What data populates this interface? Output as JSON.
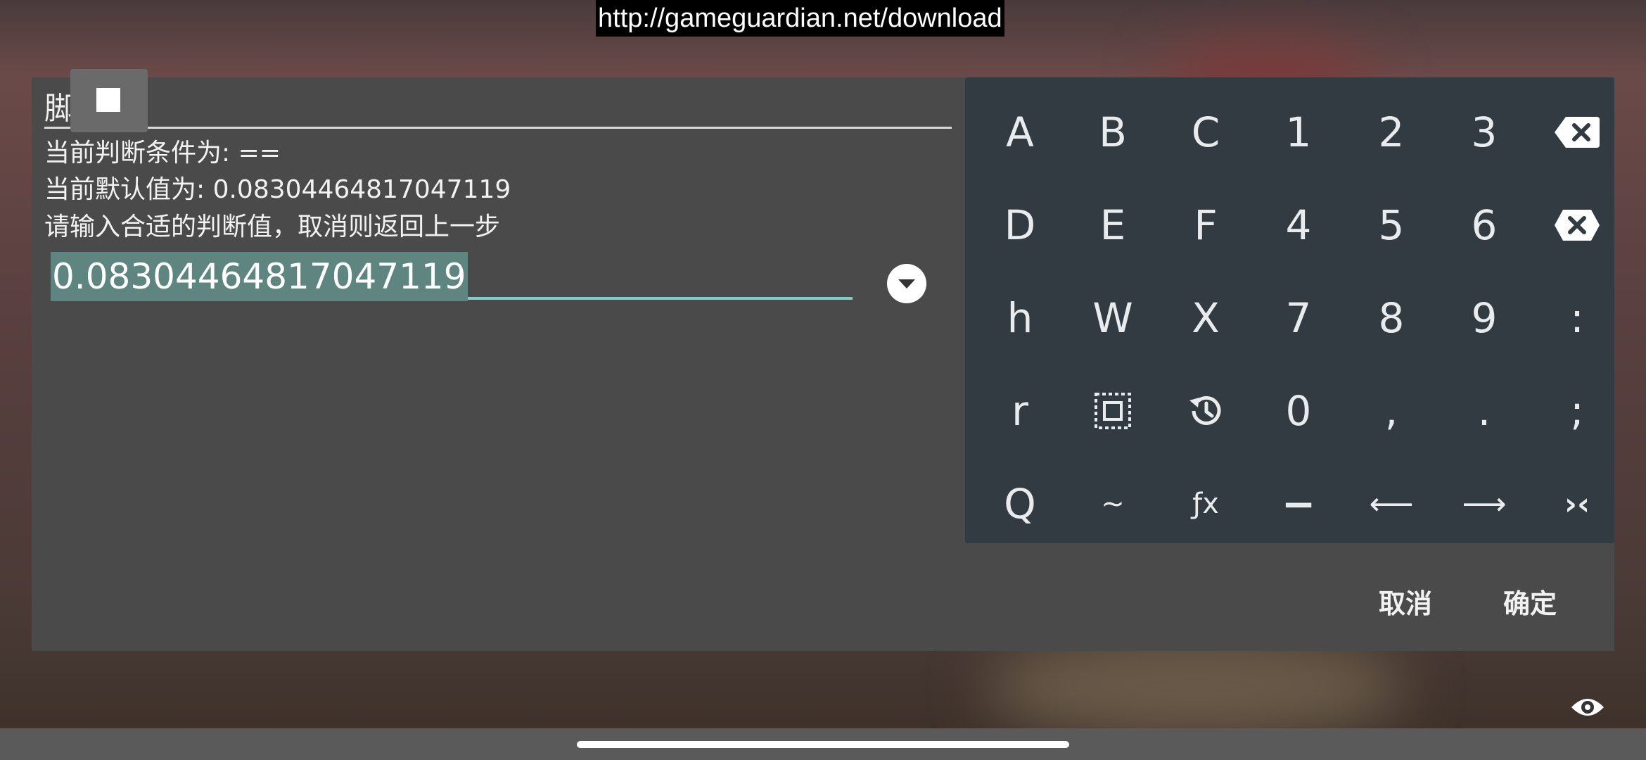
{
  "banner": {
    "url": "http://gameguardian.net/download"
  },
  "dialog": {
    "title": "脚",
    "condition_line": "当前判断条件为: ==",
    "default_line": "当前默认值为: 0.08304464817047119",
    "prompt_line": "请输入合适的判断值，取消则返回上一步",
    "input_value": "0.08304464817047119",
    "cancel_label": "取消",
    "ok_label": "确定"
  },
  "keyboard": {
    "rows": [
      [
        "A",
        "B",
        "C",
        "1",
        "2",
        "3",
        "backspace-icon"
      ],
      [
        "D",
        "E",
        "F",
        "4",
        "5",
        "6",
        "clear-icon"
      ],
      [
        "h",
        "W",
        "X",
        "7",
        "8",
        "9",
        ":"
      ],
      [
        "r",
        "select-all-icon",
        "history-icon",
        "0",
        ",",
        ".",
        ";"
      ],
      [
        "Q",
        "~",
        "ƒx",
        "−",
        "⟵",
        "⟶",
        "›‹"
      ]
    ]
  },
  "colors": {
    "dialog_bg": "#4a4a4a",
    "keyboard_bg": "#333b42",
    "input_highlight": "#5e8580",
    "input_underline": "#7fcfc4"
  }
}
